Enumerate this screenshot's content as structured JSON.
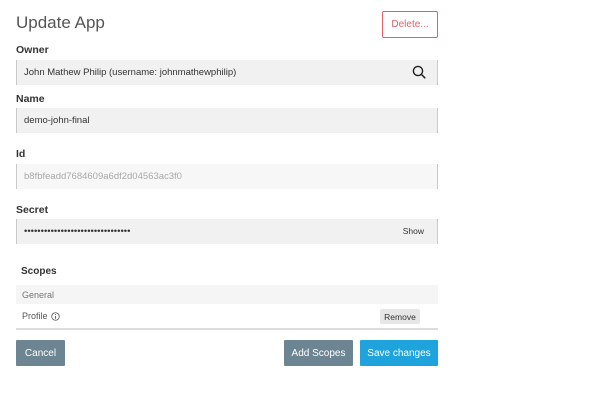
{
  "page": {
    "title": "Update App",
    "delete_label": "Delete..."
  },
  "owner": {
    "label": "Owner",
    "value": "John Mathew Philip (username: johnmathewphilip)",
    "icon": "search-icon"
  },
  "name": {
    "label": "Name",
    "value": "demo-john-final"
  },
  "id": {
    "label": "Id",
    "value": "b8fbfeadd7684609a6df2d04563ac3f0"
  },
  "secret": {
    "label": "Secret",
    "value": "••••••••••••••••••••••••••••••••",
    "show_label": "Show"
  },
  "scopes": {
    "title": "Scopes",
    "group": "General",
    "items": [
      {
        "label": "Profile",
        "icon": "info-icon",
        "action_label": "Remove"
      }
    ]
  },
  "actions": {
    "cancel_label": "Cancel",
    "add_scopes_label": "Add Scopes",
    "save_label": "Save changes"
  },
  "colors": {
    "danger": "#e4606d",
    "secondary": "#6d8593",
    "primary": "#1ea3dc"
  }
}
